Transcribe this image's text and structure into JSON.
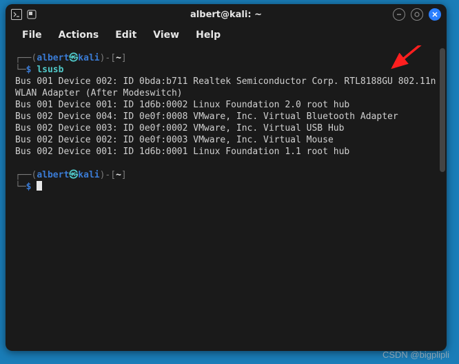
{
  "titlebar": {
    "title": "albert@kali: ~"
  },
  "menubar": {
    "items": [
      "File",
      "Actions",
      "Edit",
      "View",
      "Help"
    ]
  },
  "prompt": {
    "open": "┌──(",
    "user": "albert",
    "at": "㉿",
    "host": "kali",
    "close": ")-[",
    "cwd": "~",
    "end": "]",
    "line2_prefix": "└─",
    "dollar": "$"
  },
  "command1": "lsusb",
  "output_lines": [
    "Bus 001 Device 002: ID 0bda:b711 Realtek Semiconductor Corp. RTL8188GU 802.11n WLAN Adapter (After Modeswitch)",
    "Bus 001 Device 001: ID 1d6b:0002 Linux Foundation 2.0 root hub",
    "Bus 002 Device 004: ID 0e0f:0008 VMware, Inc. Virtual Bluetooth Adapter",
    "Bus 002 Device 003: ID 0e0f:0002 VMware, Inc. Virtual USB Hub",
    "Bus 002 Device 002: ID 0e0f:0003 VMware, Inc. Virtual Mouse",
    "Bus 002 Device 001: ID 1d6b:0001 Linux Foundation 1.1 root hub"
  ],
  "watermark": "CSDN @bigplipli"
}
